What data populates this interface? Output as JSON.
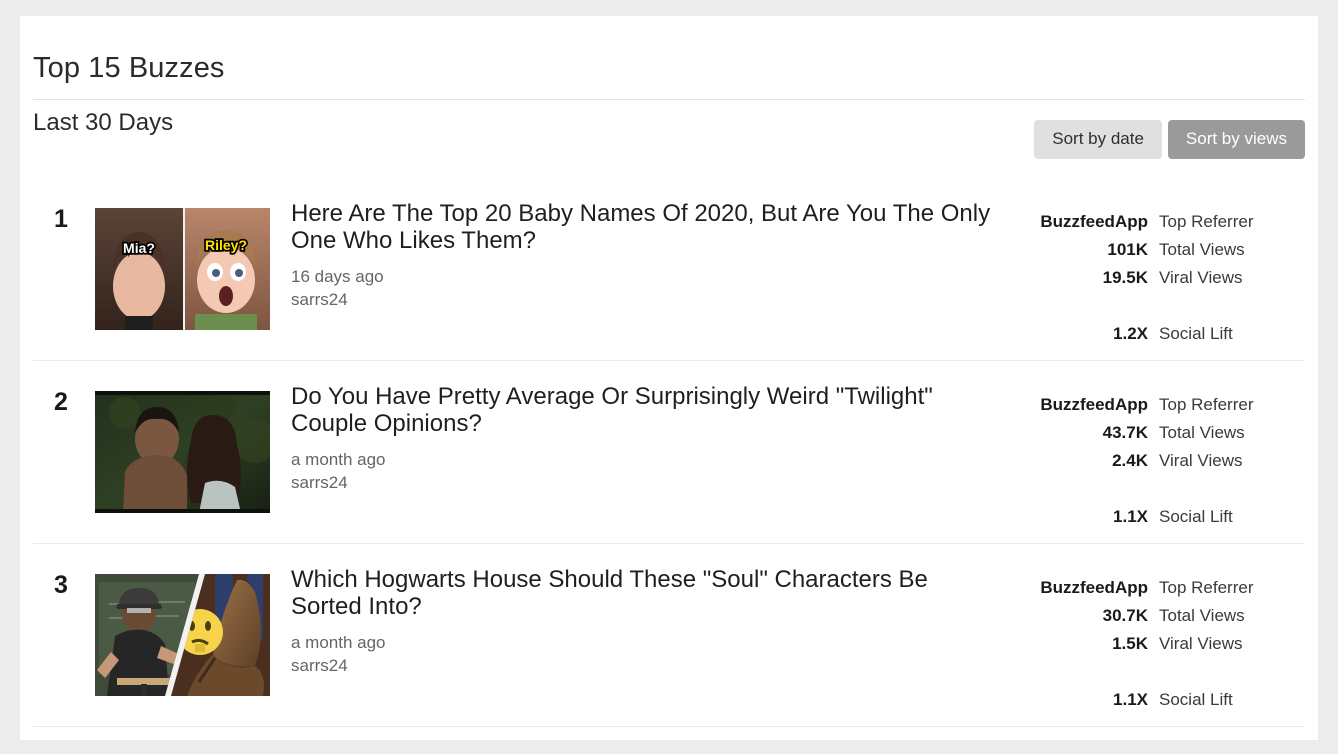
{
  "panel": {
    "title": "Top 15 Buzzes",
    "subtitle": "Last 30 Days"
  },
  "sort": {
    "by_date_label": "Sort by date",
    "by_views_label": "Sort by views",
    "active": "by_views",
    "inactive_bg": "#e0e0e0",
    "active_bg": "#9a9a9a"
  },
  "stat_labels": {
    "top_referrer": "Top Referrer",
    "total_views": "Total Views",
    "viral_views": "Viral Views",
    "social_lift": "Social Lift"
  },
  "rows": [
    {
      "rank": "1",
      "title": "Here Are The Top 20 Baby Names Of 2020, But Are You The Only One Who Likes Them?",
      "age": "16 days ago",
      "author": "sarrs24",
      "thumb": {
        "kind": "split-vertical",
        "left_caption": "Mia?",
        "left_caption_color": "#ffffff",
        "right_caption": "Riley?",
        "right_caption_color": "#ffe400"
      },
      "stats": {
        "top_referrer": "BuzzfeedApp",
        "total_views": "101K",
        "viral_views": "19.5K",
        "social_lift": "1.2X"
      }
    },
    {
      "rank": "2",
      "title": "Do You Have Pretty Average Or Surprisingly Weird \"Twilight\" Couple Opinions?",
      "age": "a month ago",
      "author": "sarrs24",
      "thumb": {
        "kind": "photo-forest"
      },
      "stats": {
        "top_referrer": "BuzzfeedApp",
        "total_views": "43.7K",
        "viral_views": "2.4K",
        "social_lift": "1.1X"
      }
    },
    {
      "rank": "3",
      "title": "Which Hogwarts House Should These \"Soul\" Characters Be Sorted Into?",
      "age": "a month ago",
      "author": "sarrs24",
      "thumb": {
        "kind": "split-diagonal"
      },
      "stats": {
        "top_referrer": "BuzzfeedApp",
        "total_views": "30.7K",
        "viral_views": "1.5K",
        "social_lift": "1.1X"
      }
    }
  ]
}
